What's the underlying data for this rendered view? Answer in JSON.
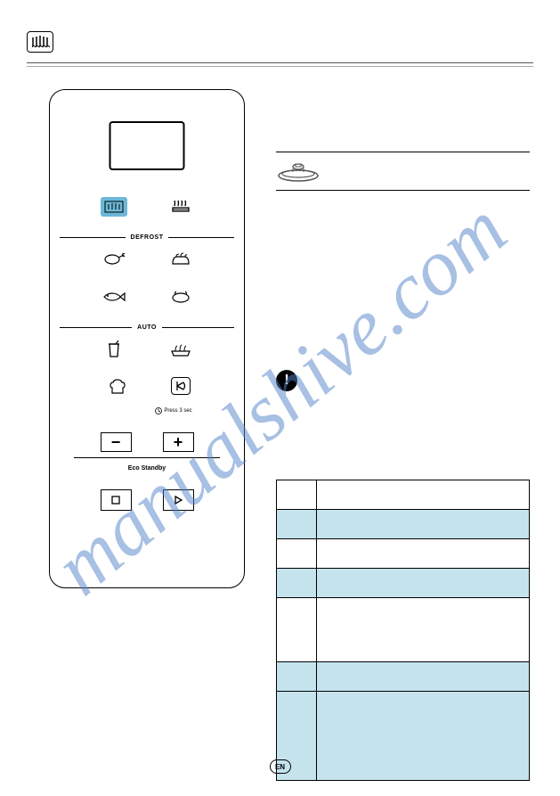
{
  "header": {
    "icon_name": "microwave-waves"
  },
  "panel": {
    "defrost_label": "DEFROST",
    "auto_label": "AUTO",
    "press_label": "Press 3 sec",
    "eco_label": "Eco Standby",
    "minus": "−",
    "plus": "+",
    "stop": "□",
    "play": "▷"
  },
  "icons": {
    "microwave": "microwave",
    "grill": "grill",
    "meat": "meat",
    "bread": "bread",
    "fish": "fish",
    "poultry": "poultry",
    "drink": "drink",
    "vegetable": "vegetable",
    "chef": "chef-hat",
    "jet": "jet-start",
    "clock": "clock"
  },
  "table": {
    "rows": [
      {
        "class": "row-white",
        "cells": [
          "",
          ""
        ]
      },
      {
        "class": "row-blue",
        "cells": [
          "",
          ""
        ]
      },
      {
        "class": "row-white",
        "cells": [
          "",
          ""
        ]
      },
      {
        "class": "row-blue",
        "cells": [
          "",
          ""
        ]
      },
      {
        "class": "row-white row-tall",
        "cells": [
          "",
          ""
        ]
      },
      {
        "class": "row-blue",
        "cells": [
          "",
          ""
        ]
      },
      {
        "class": "row-blue row-xtall",
        "cells": [
          "",
          ""
        ]
      }
    ]
  },
  "footer": {
    "lang": "EN"
  },
  "watermark": "manualshive.com"
}
